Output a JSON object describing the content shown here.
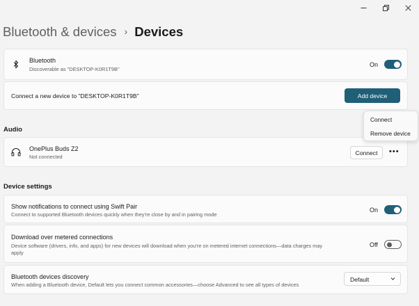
{
  "window": {
    "minimize_icon": "minimize-icon",
    "maximize_icon": "restore-icon",
    "close_icon": "close-icon"
  },
  "breadcrumb": {
    "parent": "Bluetooth & devices",
    "separator": "›",
    "current": "Devices"
  },
  "bluetooth": {
    "icon": "bluetooth-icon",
    "title": "Bluetooth",
    "subtitle": "Discoverable as \"DESKTOP-K0R1T9B\"",
    "state_label": "On",
    "enabled": true
  },
  "connect_new": {
    "text": "Connect a new device to \"DESKTOP-K0R1T9B\"",
    "button_label": "Add device"
  },
  "context_menu": {
    "items": [
      "Connect",
      "Remove device"
    ]
  },
  "audio": {
    "section_label": "Audio",
    "devices": [
      {
        "icon": "headphones-icon",
        "name": "OnePlus Buds Z2",
        "status": "Not connected",
        "button_label": "Connect",
        "more_label": "•••"
      }
    ]
  },
  "device_settings": {
    "section_label": "Device settings",
    "swift_pair": {
      "title": "Show notifications to connect using Swift Pair",
      "subtitle": "Connect to supported Bluetooth devices quickly when they're close by and in pairing mode",
      "state_label": "On",
      "enabled": true
    },
    "metered": {
      "title": "Download over metered connections",
      "subtitle_line1": "Device software (drivers, info, and apps) for new devices will download when you're on metered internet connections—data charges may",
      "subtitle_line2": "apply",
      "state_label": "Off",
      "enabled": false
    },
    "discovery": {
      "title": "Bluetooth devices discovery",
      "subtitle": "When adding a Bluetooth device, Default lets you connect common accessories—choose Advanced to see all types of devices",
      "selected": "Default"
    }
  },
  "colors": {
    "accent": "#1f5f78",
    "background": "#f3f3f3",
    "card": "#fbfbfb"
  }
}
